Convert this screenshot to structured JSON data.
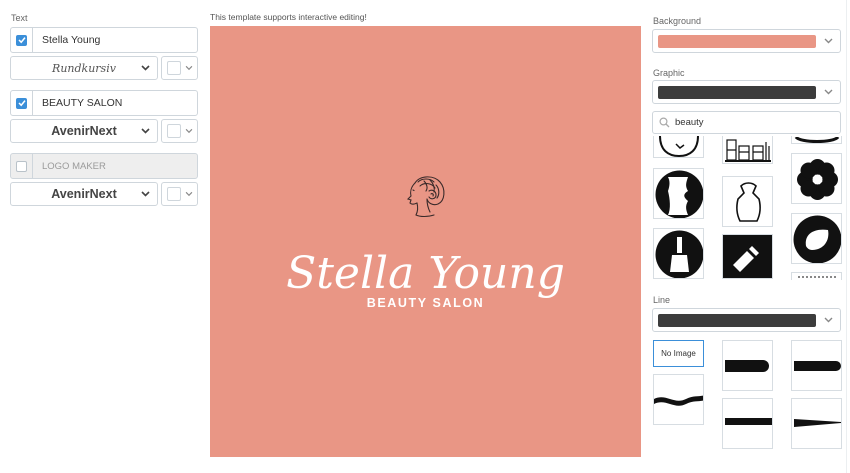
{
  "text_panel": {
    "label": "Text",
    "rows": [
      {
        "checked": true,
        "value": "Stella Young",
        "font": "Rundkursiv"
      },
      {
        "checked": true,
        "value": "BEAUTY SALON",
        "font": "AvenirNext"
      },
      {
        "checked": false,
        "value": "LOGO MAKER",
        "font": "AvenirNext"
      }
    ]
  },
  "canvas": {
    "hint": "This template supports interactive editing!",
    "background_color": "#e99685",
    "name_text": "Stella Young",
    "subtitle_text": "BEAUTY SALON",
    "text_color": "#ffffff",
    "graphic_icon": "woman-profile-updo-icon"
  },
  "right_panel": {
    "background_label": "Background",
    "background_color": "#e99685",
    "graphic_label": "Graphic",
    "graphic_color": "#3c3c3c",
    "search_value": "beauty",
    "graphic_results": [
      "mirror-icon",
      "salon-chairs-icon",
      "flower-icon",
      "face-profile-icon",
      "apron-icon",
      "nail-polish-icon",
      "nail-file-icon",
      "petal-icon"
    ],
    "line_label": "Line",
    "line_color": "#3c3c3c",
    "line_options": {
      "no_image_label": "No Image",
      "styles": [
        "rounded-end-line-icon",
        "rounded-right-line-icon",
        "wave-line-icon",
        "bracket-line-icon",
        "taper-line-icon"
      ]
    }
  }
}
